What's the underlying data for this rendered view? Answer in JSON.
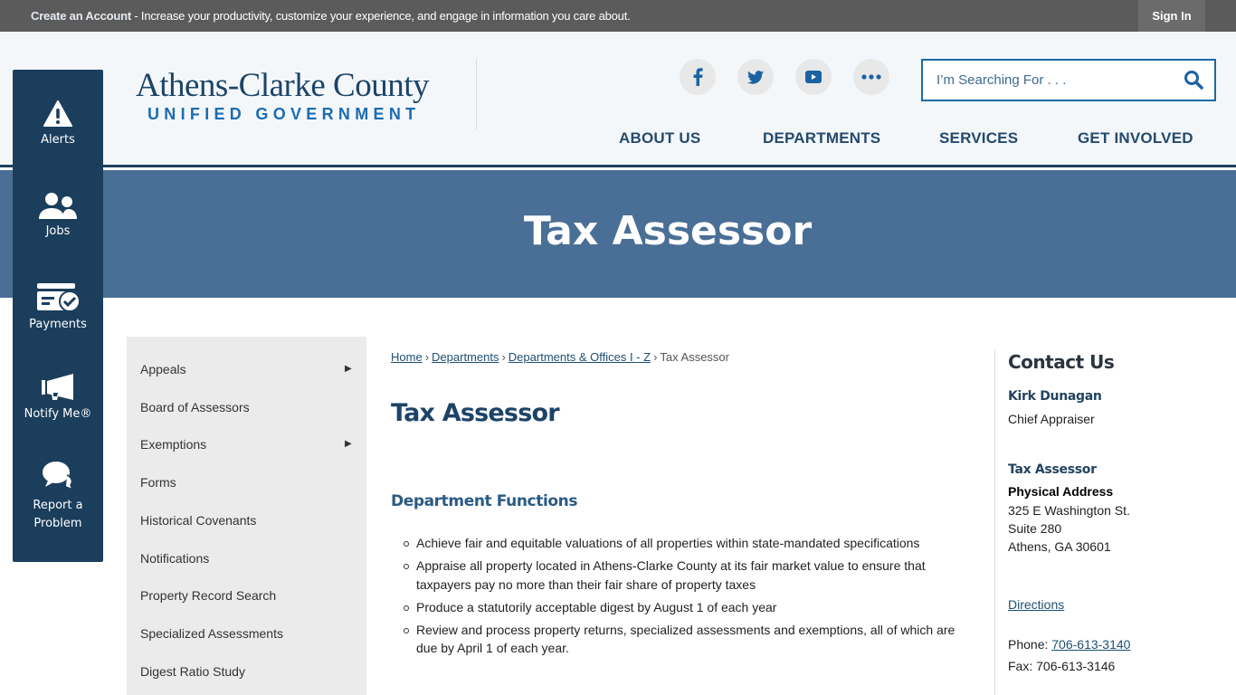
{
  "topbar": {
    "create_account": "Create an Account",
    "message": " - Increase your productivity, customize your experience, and engage in information you care about.",
    "sign_in": "Sign In"
  },
  "logo": {
    "line1": "Athens-Clarke County",
    "line2": "UNIFIED GOVERNMENT"
  },
  "social": [
    "facebook-icon",
    "twitter-icon",
    "youtube-icon",
    "more-icon"
  ],
  "search": {
    "placeholder": "I’m Searching For . . ."
  },
  "nav": [
    "ABOUT US",
    "DEPARTMENTS",
    "SERVICES",
    "GET INVOLVED"
  ],
  "banner": {
    "title": "Tax Assessor"
  },
  "quick_links": [
    {
      "label": "Alerts",
      "icon": "alert-icon"
    },
    {
      "label": "Jobs",
      "icon": "users-icon"
    },
    {
      "label": "Payments",
      "icon": "payment-icon"
    },
    {
      "label": "Notify Me®",
      "icon": "megaphone-icon"
    },
    {
      "label": "Report a Problem",
      "icon": "chat-icon"
    }
  ],
  "subnav": [
    {
      "label": "Appeals",
      "has_children": true
    },
    {
      "label": "Board of Assessors",
      "has_children": false
    },
    {
      "label": "Exemptions",
      "has_children": true
    },
    {
      "label": "Forms",
      "has_children": false
    },
    {
      "label": "Historical Covenants",
      "has_children": false
    },
    {
      "label": "Notifications",
      "has_children": false
    },
    {
      "label": "Property Record Search",
      "has_children": false
    },
    {
      "label": "Specialized Assessments",
      "has_children": false
    },
    {
      "label": "Digest Ratio Study",
      "has_children": false
    }
  ],
  "breadcrumb": {
    "items": [
      "Home",
      "Departments",
      "Departments & Offices I - Z"
    ],
    "current": "Tax Assessor",
    "separator": "›"
  },
  "main": {
    "title": "Tax Assessor",
    "section_heading": "Department Functions",
    "functions": [
      "Achieve fair and equitable valuations of all properties within state-mandated specifications",
      "Appraise all property located in Athens-Clarke County at its fair market value to ensure that taxpayers pay no more than their fair share of property taxes",
      "Produce a statutorily acceptable digest by August 1 of each year",
      "Review and process property returns, specialized assessments and exemptions, all of which are due by April 1 of each year."
    ]
  },
  "contact": {
    "title": "Contact Us",
    "person_name": "Kirk Dunagan",
    "person_title": "Chief Appraiser",
    "office": "Tax Assessor",
    "address_label": "Physical Address",
    "address_line1": "325 E Washington St.",
    "address_line2": "Suite 280",
    "address_line3": "Athens, GA 30601",
    "directions": "Directions",
    "phone_label": "Phone: ",
    "phone": "706-613-3140",
    "fax": "Fax: 706-613-3146"
  }
}
